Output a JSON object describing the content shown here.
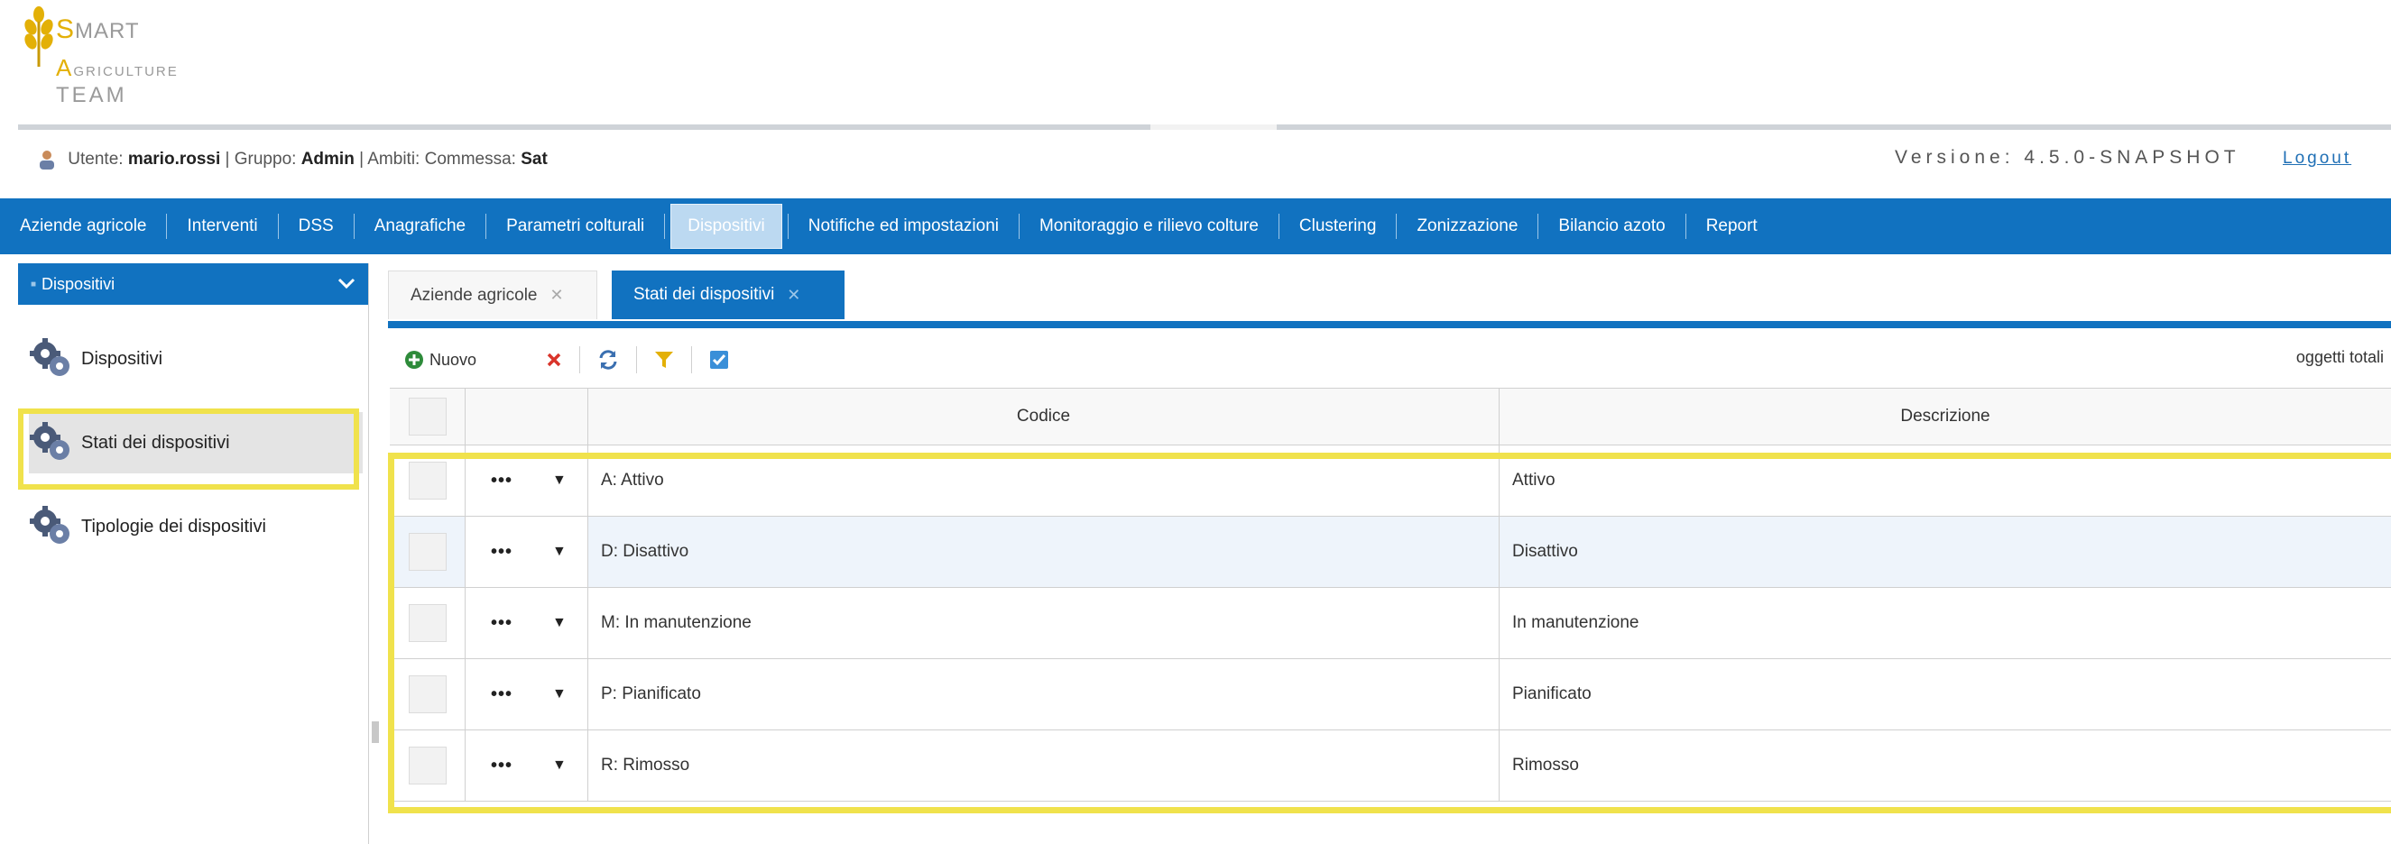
{
  "logo": {
    "line1_initial": "S",
    "line1_rest": "MART",
    "line2_initial": "A",
    "line2_rest": "GRICULTURE",
    "line3": "TEAM"
  },
  "user_bar": {
    "user_label": "Utente:",
    "user_name": "mario.rossi",
    "group_label": "| Gruppo:",
    "group_name": "Admin",
    "scope_label": "| Ambiti: Commessa:",
    "scope_name": "Sat",
    "version": "Versione: 4.5.0-SNAPSHOT",
    "logout": "Logout"
  },
  "nav": {
    "items": [
      {
        "label": "Aziende agricole"
      },
      {
        "label": "Interventi"
      },
      {
        "label": "DSS"
      },
      {
        "label": "Anagrafiche"
      },
      {
        "label": "Parametri colturali"
      },
      {
        "label": "Dispositivi"
      },
      {
        "label": "Notifiche ed impostazioni"
      },
      {
        "label": "Monitoraggio e rilievo colture"
      },
      {
        "label": "Clustering"
      },
      {
        "label": "Zonizzazione"
      },
      {
        "label": "Bilancio azoto"
      },
      {
        "label": "Report"
      }
    ],
    "active_index": 5
  },
  "sidebar": {
    "header": "Dispositivi",
    "items": [
      {
        "label": "Dispositivi"
      },
      {
        "label": "Stati dei dispositivi"
      },
      {
        "label": "Tipologie dei dispositivi"
      }
    ]
  },
  "tabs": [
    {
      "label": "Aziende agricole",
      "close": "✕"
    },
    {
      "label": "Stati dei dispositivi",
      "close": "✕"
    }
  ],
  "toolbar": {
    "new_label": "Nuovo",
    "count_label": "oggetti totali"
  },
  "grid": {
    "columns": [
      "Codice",
      "Descrizione"
    ],
    "rows": [
      {
        "codice": "A: Attivo",
        "descrizione": "Attivo"
      },
      {
        "codice": "D: Disattivo",
        "descrizione": "Disattivo"
      },
      {
        "codice": "M: In manutenzione",
        "descrizione": "In manutenzione"
      },
      {
        "codice": "P: Pianificato",
        "descrizione": "Pianificato"
      },
      {
        "codice": "R: Rimosso",
        "descrizione": "Rimosso"
      }
    ],
    "row_actions": "•••",
    "row_caret": "▼"
  },
  "colors": {
    "nav_blue": "#1172c0",
    "highlight_yellow": "#f0e24c",
    "brand_gold": "#e3b007"
  },
  "icons": [
    "wheat-logo-icon",
    "user-icon",
    "chevron-down-icon",
    "gear-icon",
    "close-icon",
    "add-icon",
    "delete-icon",
    "refresh-icon",
    "filter-icon",
    "checkbox-icon"
  ]
}
